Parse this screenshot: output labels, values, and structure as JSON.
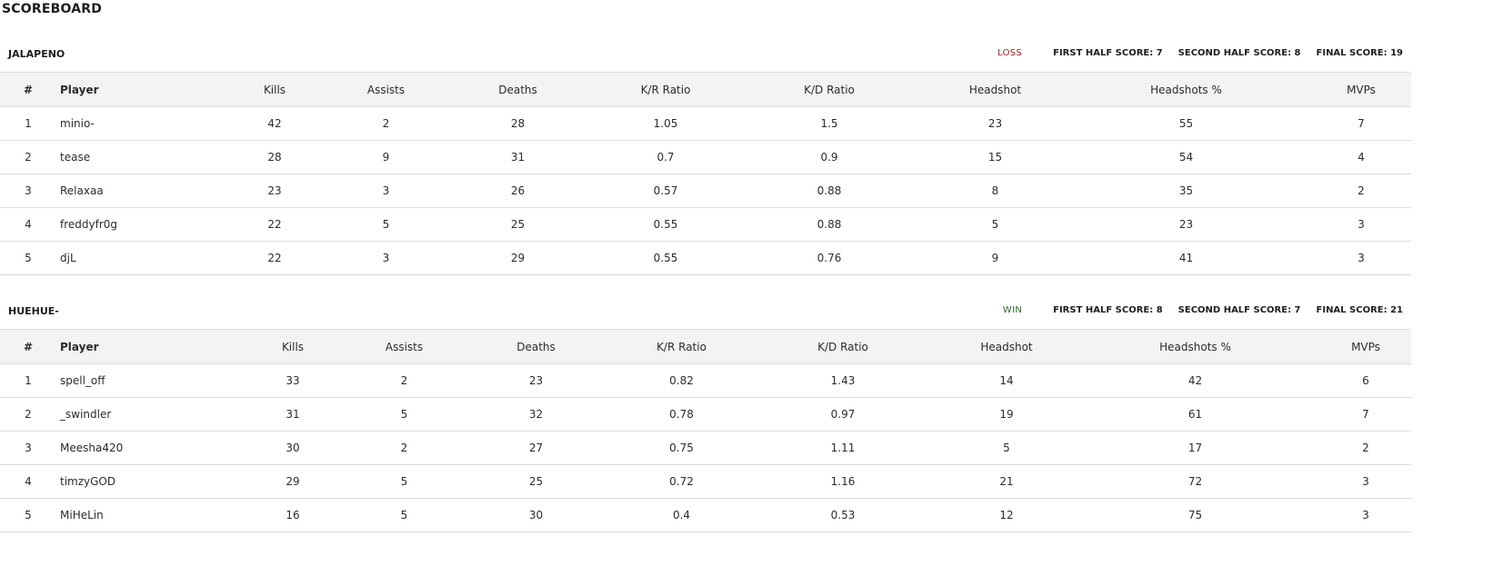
{
  "page_title": "SCOREBOARD",
  "columns": [
    "#",
    "Player",
    "Kills",
    "Assists",
    "Deaths",
    "K/R Ratio",
    "K/D Ratio",
    "Headshot",
    "Headshots %",
    "MVPs"
  ],
  "teams": [
    {
      "name": "JALAPENO",
      "result": "LOSS",
      "first_half": "FIRST HALF SCORE: 7",
      "second_half": "SECOND HALF SCORE: 8",
      "final": "FINAL SCORE: 19",
      "players": [
        [
          "1",
          "minio-",
          "42",
          "2",
          "28",
          "1.05",
          "1.5",
          "23",
          "55",
          "7"
        ],
        [
          "2",
          "tease",
          "28",
          "9",
          "31",
          "0.7",
          "0.9",
          "15",
          "54",
          "4"
        ],
        [
          "3",
          "Relaxaa",
          "23",
          "3",
          "26",
          "0.57",
          "0.88",
          "8",
          "35",
          "2"
        ],
        [
          "4",
          "freddyfr0g",
          "22",
          "5",
          "25",
          "0.55",
          "0.88",
          "5",
          "23",
          "3"
        ],
        [
          "5",
          "djL",
          "22",
          "3",
          "29",
          "0.55",
          "0.76",
          "9",
          "41",
          "3"
        ]
      ]
    },
    {
      "name": "HUEHUE-",
      "result": "WIN",
      "first_half": "FIRST HALF SCORE: 8",
      "second_half": "SECOND HALF SCORE: 7",
      "final": "FINAL SCORE: 21",
      "players": [
        [
          "1",
          "spell_off",
          "33",
          "2",
          "23",
          "0.82",
          "1.43",
          "14",
          "42",
          "6"
        ],
        [
          "2",
          "_swindler",
          "31",
          "5",
          "32",
          "0.78",
          "0.97",
          "19",
          "61",
          "7"
        ],
        [
          "3",
          "Meesha420",
          "30",
          "2",
          "27",
          "0.75",
          "1.11",
          "5",
          "17",
          "2"
        ],
        [
          "4",
          "timzyGOD",
          "29",
          "5",
          "25",
          "0.72",
          "1.16",
          "21",
          "72",
          "3"
        ],
        [
          "5",
          "MiHeLin",
          "16",
          "5",
          "30",
          "0.4",
          "0.53",
          "12",
          "75",
          "3"
        ]
      ]
    }
  ],
  "colors": {
    "loss": "#a02020",
    "win": "#2d6a2d",
    "header_bg": "#f3f3f3",
    "border": "#dcdcdc"
  }
}
